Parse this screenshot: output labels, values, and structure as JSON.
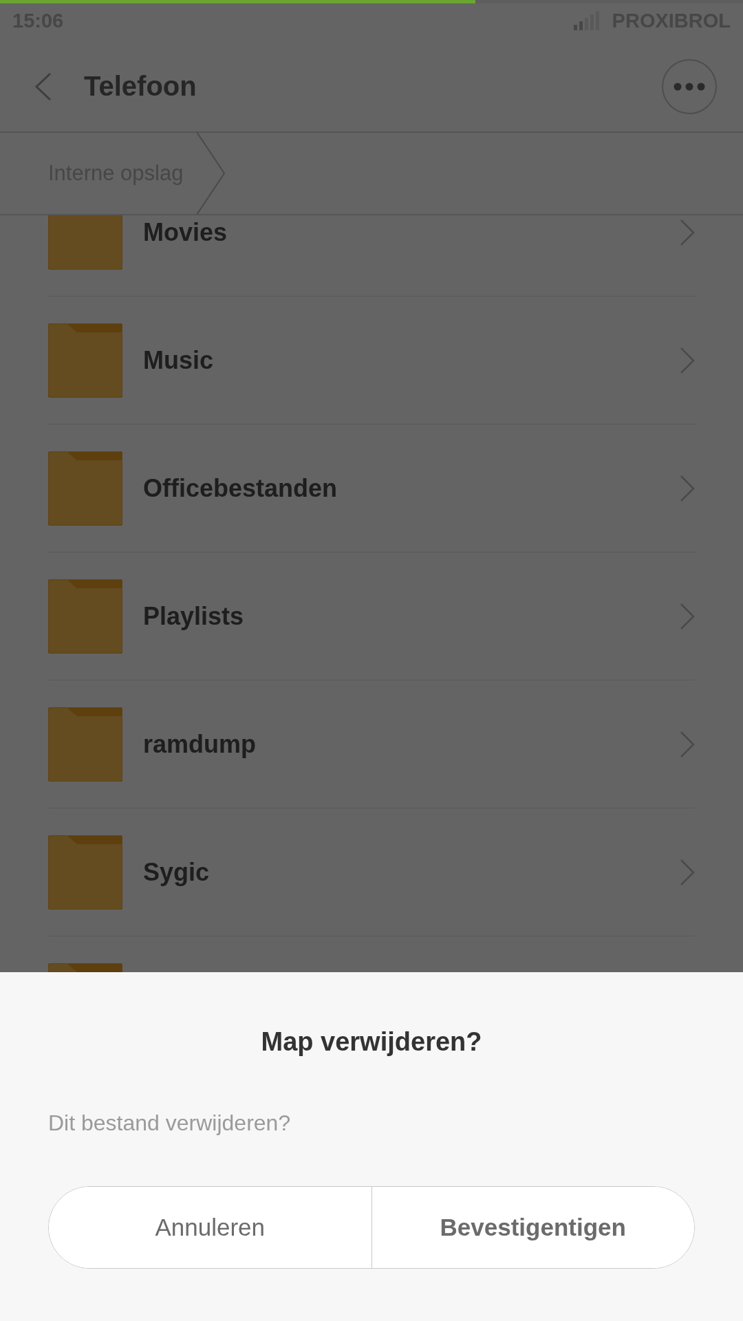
{
  "status_bar": {
    "time": "15:06",
    "carrier": "PROXIBROL"
  },
  "progress": {
    "level": 0.64
  },
  "header": {
    "title": "Telefoon"
  },
  "breadcrumb": [
    {
      "label": "Interne opslag"
    }
  ],
  "folders": [
    {
      "name": "Movies"
    },
    {
      "name": "Music"
    },
    {
      "name": "Officebestanden"
    },
    {
      "name": "Playlists"
    },
    {
      "name": "ramdump"
    },
    {
      "name": "Sygic"
    }
  ],
  "more_below": true,
  "dialog": {
    "title": "Map verwijderen?",
    "message": "Dit bestand verwijderen?",
    "buttons": [
      {
        "label": "Annuleren",
        "primary": false
      },
      {
        "label": "Bevestigentigen",
        "primary": true
      }
    ]
  }
}
